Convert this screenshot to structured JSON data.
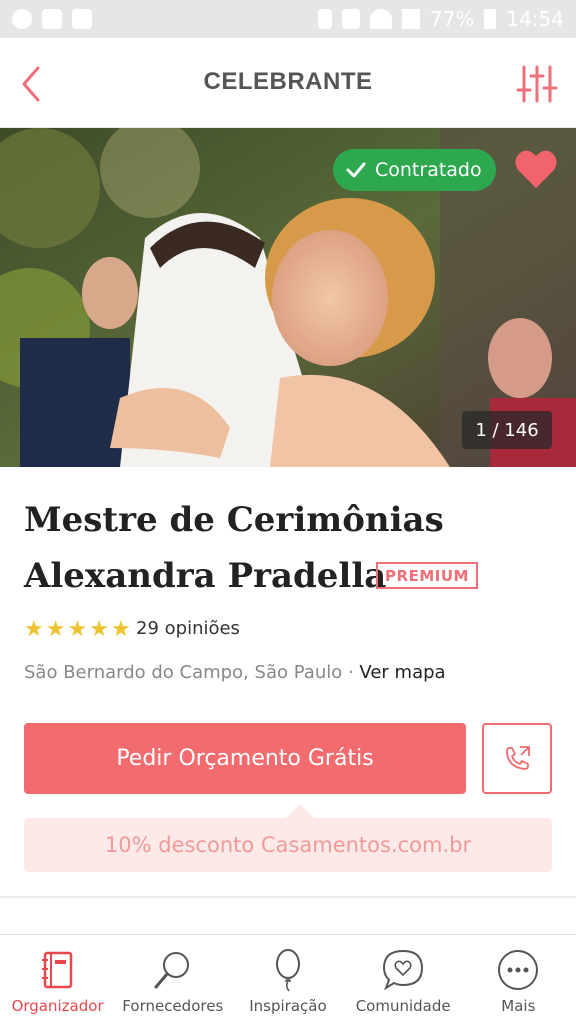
{
  "status_bar": {
    "battery": "77%",
    "time": "14:54"
  },
  "header": {
    "title": "CELEBRANTE",
    "back_icon": "chevron-left-icon",
    "filter_icon": "sliders-icon"
  },
  "hero": {
    "badge_label": "Contratado",
    "counter": "1 / 146"
  },
  "vendor": {
    "name_line1": "Mestre de Cerimônias",
    "name_line2": "Alexandra Pradella",
    "premium_label": "PREMIUM",
    "rating_stars": 5,
    "opinions": "29 opiniões",
    "location": "São Bernardo do Campo, São Paulo · ",
    "map_link": "Ver mapa"
  },
  "actions": {
    "quote_button": "Pedir Orçamento Grátis",
    "discount": "10% desconto Casamentos.com.br"
  },
  "bottom_nav": [
    {
      "label": "Organizador",
      "icon": "notebook-icon",
      "active": true
    },
    {
      "label": "Fornecedores",
      "icon": "magnifier-icon",
      "active": false
    },
    {
      "label": "Inspiração",
      "icon": "balloon-icon",
      "active": false
    },
    {
      "label": "Comunidade",
      "icon": "chat-heart-icon",
      "active": false
    },
    {
      "label": "Mais",
      "icon": "more-icon",
      "active": false
    }
  ],
  "colors": {
    "accent": "#f16b6f",
    "badge_green": "#2da84f",
    "star": "#efc330",
    "discount_bg": "#fde9e8"
  }
}
